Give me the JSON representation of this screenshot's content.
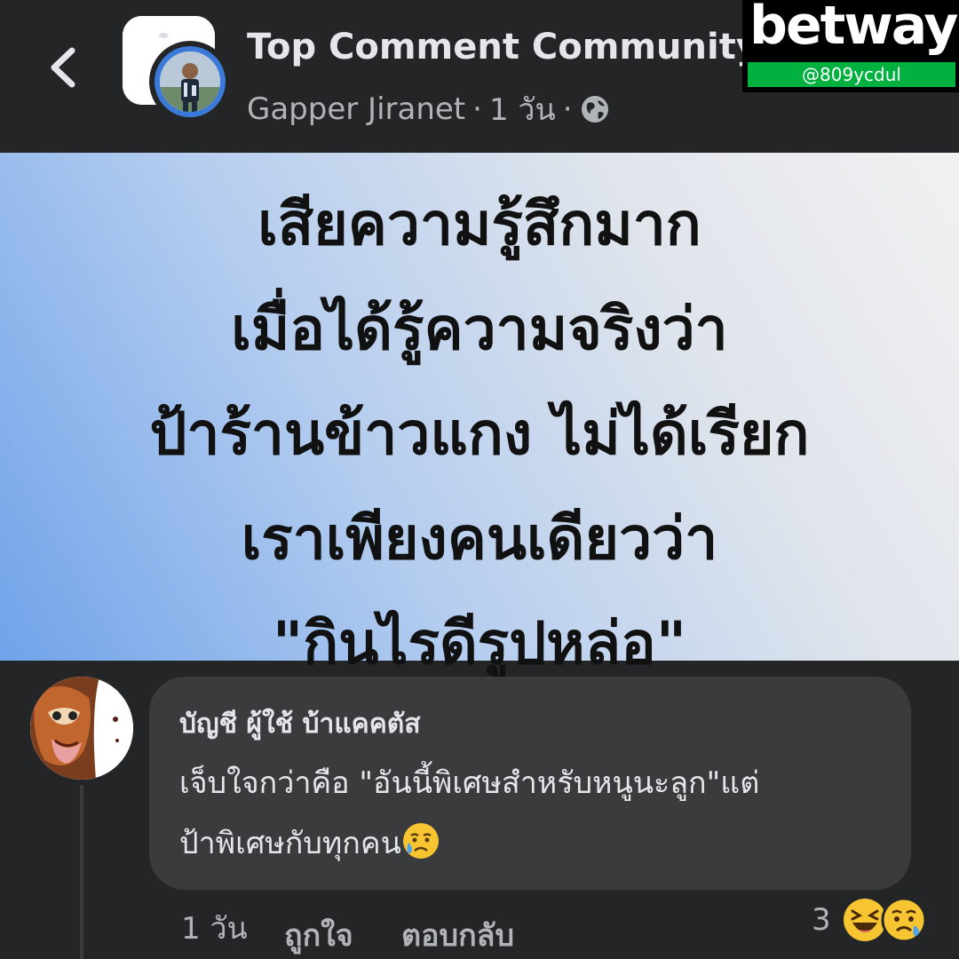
{
  "header": {
    "group_name": "Top Comment Community",
    "author": "Gapper Jiranet",
    "separator1": "·",
    "time": "1 วัน",
    "separator2": "·",
    "privacy_icon": "globe-icon",
    "back_icon": "chevron-left-icon"
  },
  "watermark": {
    "brand": "betway",
    "handle": "@809ycdul",
    "colors": {
      "background": "#000000",
      "handle_bar": "#00b140"
    }
  },
  "post_image": {
    "lines": [
      "เสียความรู้สึกมาก",
      "เมื่อได้รู้ความจริงว่า",
      "ป้าร้านข้าวแกง ไม่ได้เรียก",
      "เราเพียงคนเดียวว่า",
      "\"กินไรดีรูปหล่อ\""
    ]
  },
  "comment": {
    "author": "บัญชี ผู้ใช้ บ้าแคคตัส",
    "text_line1": "เจ็บใจกว่าคือ \"อันนี้พิเศษสำหรับหนูนะลูก\"แต่",
    "text_line2": "ป้าพิเศษกับทุกคน",
    "emoji": "crying-face-icon",
    "time": "1 วัน",
    "like_label": "ถูกใจ",
    "reply_label": "ตอบกลับ",
    "reaction_count": "3",
    "reactions": [
      "laughing-face-icon",
      "sad-face-icon"
    ]
  },
  "colors": {
    "app_background": "#242526",
    "bubble": "#3a3b3c",
    "primary_text": "#e4e6eb",
    "secondary_text": "#b0b3b8",
    "avatar_ring": "#3b7ad8"
  }
}
